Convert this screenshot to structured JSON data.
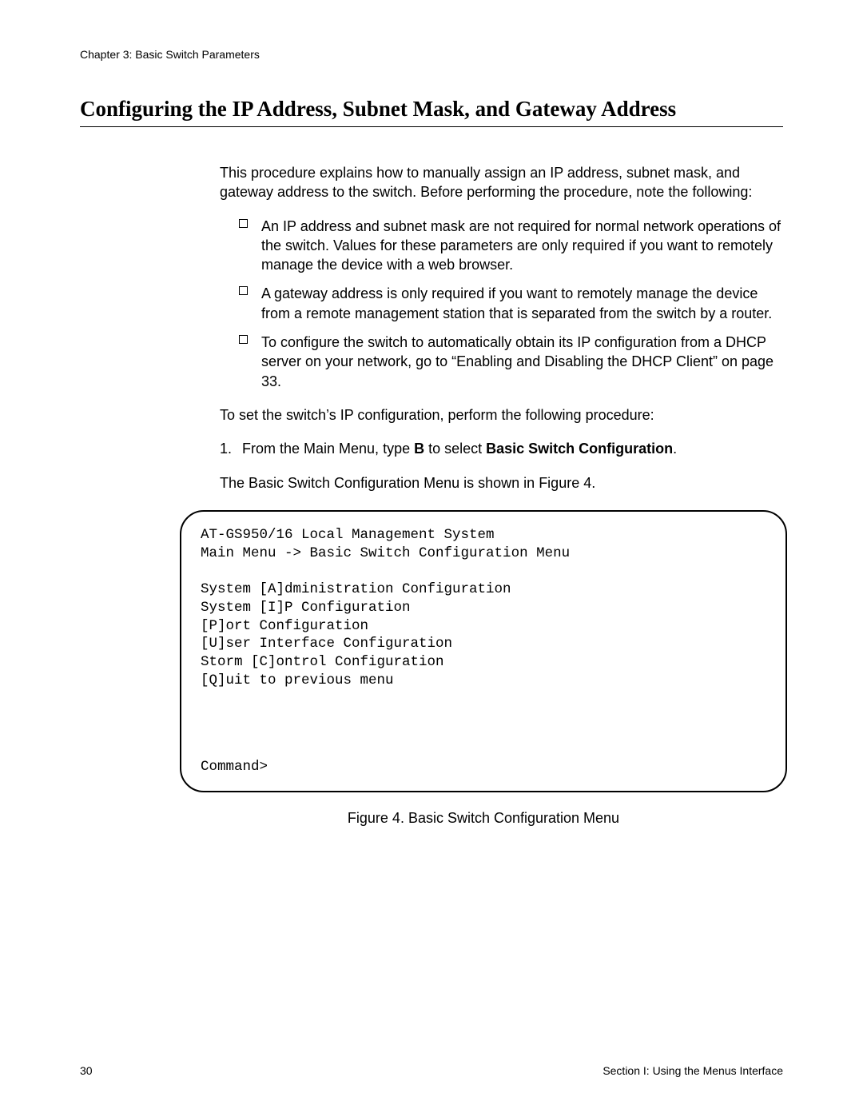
{
  "header": {
    "chapter": "Chapter 3: Basic Switch Parameters"
  },
  "title": "Configuring the IP Address, Subnet Mask, and Gateway Address",
  "intro": "This procedure explains how to manually assign an IP address, subnet mask, and gateway address to the switch. Before performing the procedure, note the following:",
  "bullets": [
    "An IP address and subnet mask are not required for normal network operations of the switch. Values for these parameters are only required if you want to remotely manage the device with a web browser.",
    "A gateway address is only required if you want to remotely manage the device from a remote management station that is separated from the switch by a router.",
    "To configure the switch to automatically obtain its IP configuration from a DHCP server on your network, go to “Enabling and Disabling the DHCP Client” on page 33."
  ],
  "lead": "To set the switch’s IP configuration, perform the following procedure:",
  "step1": {
    "num": "1.",
    "pre": "From the Main Menu, type ",
    "bold1": "B",
    "mid": " to select ",
    "bold2": "Basic Switch Configuration",
    "post": "."
  },
  "figurePara": "The Basic Switch Configuration Menu is shown in Figure 4.",
  "terminal": {
    "body": "AT-GS950/16 Local Management System\nMain Menu -> Basic Switch Configuration Menu\n\nSystem [A]dministration Configuration\nSystem [I]P Configuration\n[P]ort Configuration\n[U]ser Interface Configuration\nStorm [C]ontrol Configuration\n[Q]uit to previous menu",
    "command": "Command>"
  },
  "figureCaption": "Figure 4. Basic Switch Configuration Menu",
  "footer": {
    "pageNumber": "30",
    "section": "Section I: Using the Menus Interface"
  }
}
